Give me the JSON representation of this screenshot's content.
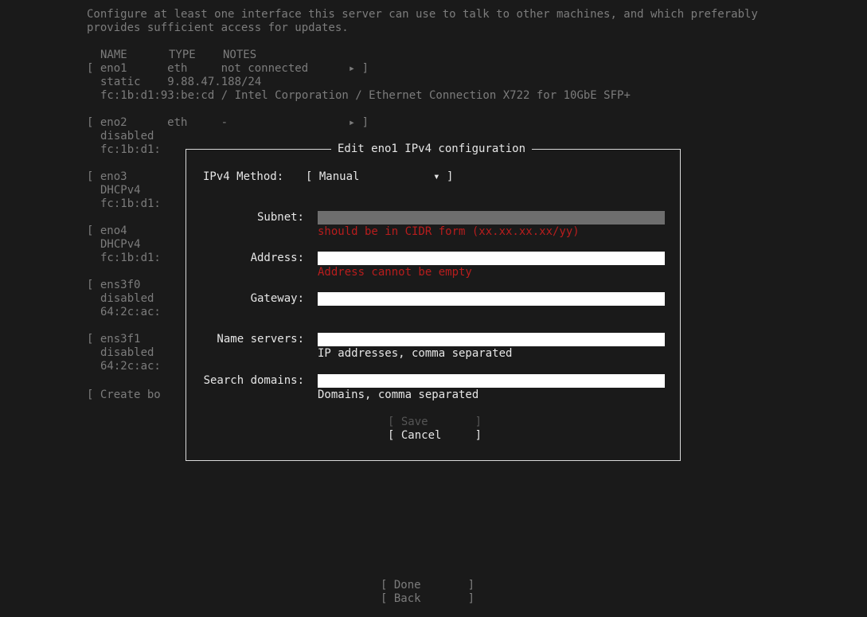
{
  "intro": {
    "line1": "Configure at least one interface this server can use to talk to other machines, and which preferably",
    "line2": "provides sufficient access for updates."
  },
  "table": {
    "headers": [
      "NAME",
      "TYPE",
      "NOTES"
    ],
    "eno1": {
      "row": "[ eno1      eth     not connected      ▸ ]",
      "sub1": "static    9.88.47.188/24",
      "sub2": "fc:1b:d1:93:be:cd / Intel Corporation / Ethernet Connection X722 for 10GbE SFP+"
    },
    "eno2": {
      "row": "[ eno2      eth     -                  ▸ ]",
      "sub1": "disabled",
      "sub2": "fc:1b:d1:"
    },
    "eno3": {
      "row": "[ eno3",
      "sub1": "DHCPv4",
      "sub2": "fc:1b:d1:"
    },
    "eno4": {
      "row": "[ eno4",
      "sub1": "DHCPv4",
      "sub2": "fc:1b:d1:"
    },
    "ens3f0": {
      "row": "[ ens3f0",
      "sub1": "disabled",
      "sub2": "64:2c:ac:"
    },
    "ens3f1": {
      "row": "[ ens3f1",
      "sub1": "disabled",
      "sub2": "64:2c:ac:"
    },
    "create_bond": "[ Create bo"
  },
  "dialog": {
    "title": "Edit eno1 IPv4 configuration",
    "method_label": "IPv4 Method:",
    "method_value": "[ Manual           ▾ ]",
    "subnet_label": "Subnet:",
    "subnet_value": "",
    "subnet_error": "should be in CIDR form (xx.xx.xx.xx/yy)",
    "address_label": "Address:",
    "address_value": "",
    "address_error": "Address cannot be empty",
    "gateway_label": "Gateway:",
    "gateway_value": "",
    "nameservers_label": "Name servers:",
    "nameservers_value": "",
    "nameservers_hint": "IP addresses, comma separated",
    "searchdomains_label": "Search domains:",
    "searchdomains_value": "",
    "searchdomains_hint": "Domains, comma separated",
    "save_label": "[ Save       ]",
    "cancel_label": "[ Cancel     ]"
  },
  "footer": {
    "done_label": "[ Done       ]",
    "back_label": "[ Back       ]"
  },
  "colors": {
    "background": "#1a1a1a",
    "text_bright": "#e6e6e6",
    "text_dim": "#7c7c7c",
    "error": "#b81d1d",
    "field": "#ffffff",
    "field_disabled": "#6e6e6e"
  }
}
